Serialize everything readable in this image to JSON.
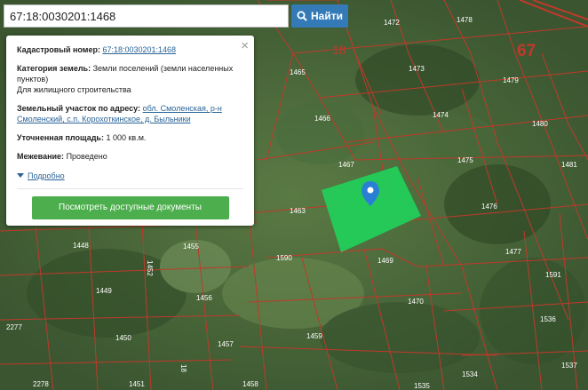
{
  "search": {
    "value": "67:18:0030201:1468",
    "button_label": "Найти"
  },
  "map": {
    "parcel_labels": [
      "1472",
      "1478",
      "1473",
      "1479",
      "1465",
      "1474",
      "1480",
      "1466",
      "1475",
      "1481",
      "1467",
      "1463",
      "1476",
      "1477",
      "1448",
      "1455",
      "1590",
      "1469",
      "1591",
      "1449",
      "1456",
      "1470",
      "1536",
      "1450",
      "1457",
      "1459",
      "2277",
      "1451",
      "2278",
      "1458",
      "1534",
      "1537",
      "1535",
      "1452",
      "18",
      "67",
      "201",
      "452",
      "1465"
    ],
    "quarter_label": "18",
    "region_label": "67",
    "colors": {
      "parcel_line": "#c0392b",
      "selected_fill": "#22d05a",
      "marker": "#2a7fd4"
    }
  },
  "popup": {
    "cadastral_label": "Кадастровый номер:",
    "cadastral_value": "67:18:0030201:1468",
    "category_label": "Категория земель:",
    "category_value": "Земли поселений (земли населенных пунктов)",
    "use_value": "Для жилищного строительства",
    "address_label": "Земельный участок по адресу:",
    "address_value": "обл. Смоленская, р-н Смоленский, с.п. Корохоткинское, д. Быльники",
    "area_label": "Уточненная площадь:",
    "area_value": "1 000 кв.м.",
    "survey_label": "Межевание:",
    "survey_value": "Проведено",
    "more_label": "Подробно",
    "docs_button": "Посмотреть доступные документы",
    "close_glyph": "×"
  }
}
